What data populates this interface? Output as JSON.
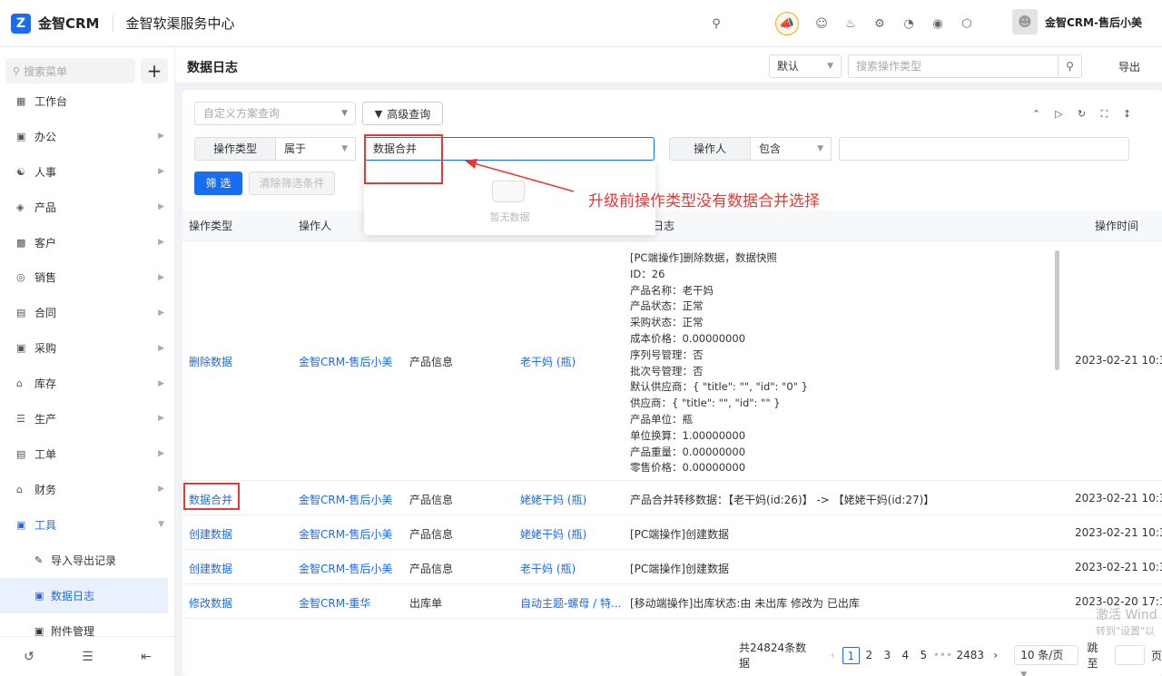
{
  "topbar": {
    "logo_glyph": "Z",
    "logo_text": "金智CRM",
    "org_name": "金智软渠服务中心",
    "user_name": "金智CRM-售后小美"
  },
  "sidebar": {
    "search_placeholder": "搜索菜单",
    "add_label": "+",
    "items": [
      {
        "label": "工作台",
        "icon": "dashboard-icon"
      },
      {
        "label": "办公",
        "icon": "office-icon"
      },
      {
        "label": "人事",
        "icon": "hr-icon"
      },
      {
        "label": "产品",
        "icon": "product-icon"
      },
      {
        "label": "客户",
        "icon": "customer-icon"
      },
      {
        "label": "销售",
        "icon": "sales-icon"
      },
      {
        "label": "合同",
        "icon": "contract-icon"
      },
      {
        "label": "采购",
        "icon": "purchase-icon"
      },
      {
        "label": "库存",
        "icon": "inventory-icon"
      },
      {
        "label": "生产",
        "icon": "production-icon"
      },
      {
        "label": "工单",
        "icon": "ticket-icon"
      },
      {
        "label": "财务",
        "icon": "finance-icon"
      },
      {
        "label": "工具",
        "icon": "tools-icon"
      }
    ],
    "sub_items": [
      {
        "label": "导入导出记录"
      },
      {
        "label": "数据日志"
      },
      {
        "label": "附件管理"
      }
    ]
  },
  "header": {
    "title": "数据日志",
    "view_select": "默认",
    "search_placeholder": "搜索操作类型",
    "export_label": "导出"
  },
  "filters": {
    "scheme_placeholder": "自定义方案查询",
    "advanced_label": "高级查询",
    "op_type_label": "操作类型",
    "op_type_operator": "属于",
    "op_type_value": "数据合并",
    "operator_label": "操作人",
    "operator_operator": "包含",
    "operator_value": "",
    "filter_btn": "筛 选",
    "clear_btn": "清除筛选条件",
    "dropdown_empty": "暂无数据"
  },
  "annotation": {
    "text": "升级前操作类型没有数据合并选择",
    "color": "#e53935"
  },
  "table": {
    "headers": [
      "操作类型",
      "操作人",
      "日志",
      "操作时间"
    ],
    "rows": [
      {
        "type": "删除数据",
        "user": "金智CRM-售后小美",
        "module": "产品信息",
        "target": "老干妈 (瓶)",
        "lines": [
          "[PC端操作]删除数据，数据快照",
          "ID：26",
          "产品名称：老干妈",
          "产品状态：正常",
          "采购状态：正常",
          "成本价格：0.00000000",
          "序列号管理：否",
          "批次号管理：否",
          "默认供应商：{ \"title\": \"\", \"id\": \"0\" }",
          "供应商：{ \"title\": \"\", \"id\": \"\" }",
          "产品单位：瓶",
          "单位换算：1.00000000",
          "产品重量：0.00000000",
          "零售价格：0.00000000"
        ],
        "time": "2023-02-21 10:3"
      },
      {
        "type": "数据合并",
        "user": "金智CRM-售后小美",
        "module": "产品信息",
        "target": "姥姥干妈 (瓶)",
        "log": "产品合并转移数据：【老干妈(id:26)】 -> 【姥姥干妈(id:27)】",
        "time": "2023-02-21 10:3"
      },
      {
        "type": "创建数据",
        "user": "金智CRM-售后小美",
        "module": "产品信息",
        "target": "姥姥干妈 (瓶)",
        "log": "[PC端操作]创建数据",
        "time": "2023-02-21 10:3"
      },
      {
        "type": "创建数据",
        "user": "金智CRM-售后小美",
        "module": "产品信息",
        "target": "老干妈 (瓶)",
        "log": "[PC端操作]创建数据",
        "time": "2023-02-21 10:3"
      },
      {
        "type": "修改数据",
        "user": "金智CRM-重华",
        "module": "出库单",
        "target": "自动主题-螺母 / 特...",
        "log": "[移动端操作]出库状态:由 未出库 修改为 已出库",
        "time": "2023-02-20 17:1"
      }
    ]
  },
  "pagination": {
    "total": "共24824条数据",
    "pages": [
      "1",
      "2",
      "3",
      "4",
      "5",
      "•••",
      "2483"
    ],
    "page_size": "10 条/页",
    "jump_label": "跳至",
    "page_suffix": "页"
  },
  "watermark": {
    "line1": "激活 Wind",
    "line2": "转到\"设置\"以"
  },
  "colors": {
    "primary": "#1a6cf0",
    "annotation": "#e53935",
    "accent_orange": "#f29b1c"
  }
}
